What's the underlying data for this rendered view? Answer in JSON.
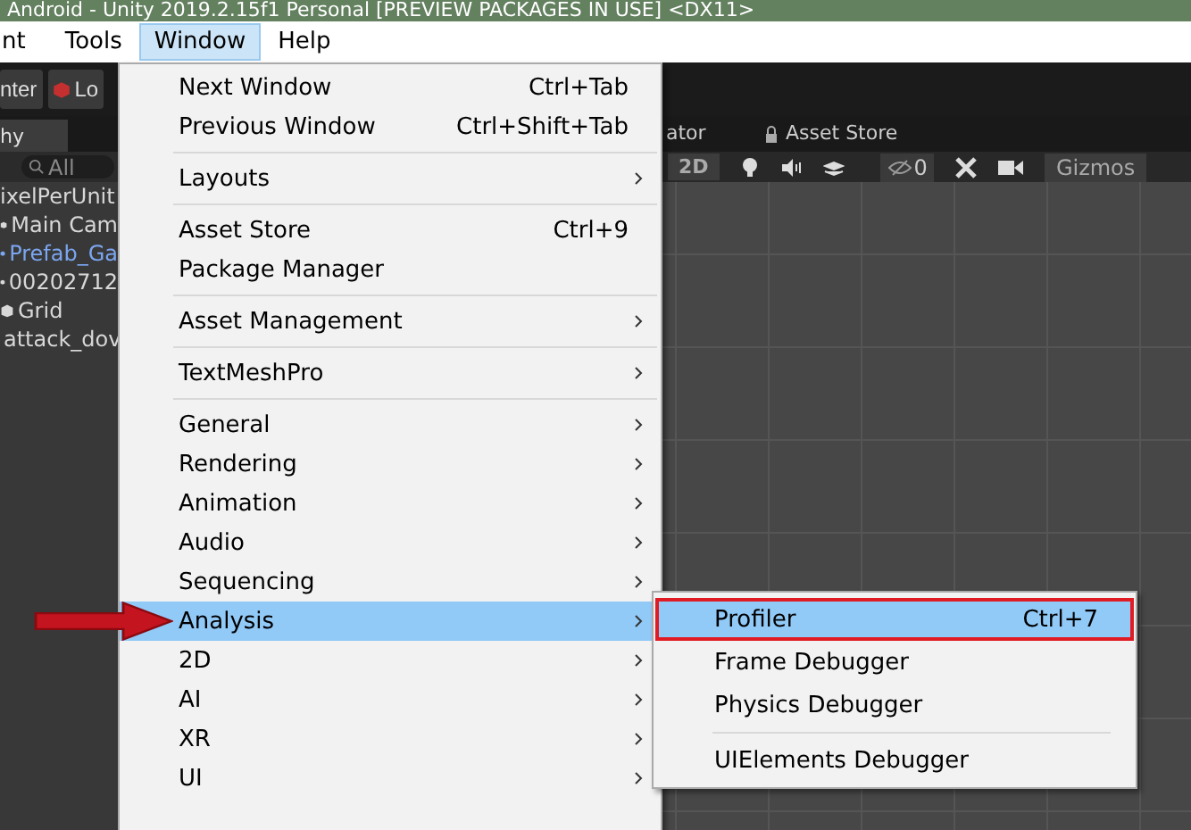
{
  "window": {
    "title": "Android - Unity 2019.2.15f1 Personal [PREVIEW PACKAGES IN USE] <DX11>"
  },
  "menu_bar": [
    {
      "label": "nt",
      "selected": false
    },
    {
      "label": "Tools",
      "selected": false
    },
    {
      "label": "Window",
      "selected": true
    },
    {
      "label": "Help",
      "selected": false
    }
  ],
  "toolbar": {
    "buttons": [
      "nter",
      "Lo"
    ]
  },
  "tabs": [
    {
      "label": "hy",
      "selected": true
    },
    {
      "label": "ator",
      "selected": false
    },
    {
      "label": "Asset Store",
      "selected": false
    }
  ],
  "hierarchy": {
    "search_placeholder": "All",
    "items": [
      {
        "label": "ixelPerUnit",
        "kind": "scene",
        "selected": false
      },
      {
        "label": "Main Cam",
        "kind": "object",
        "selected": false
      },
      {
        "label": "Prefab_Ga",
        "kind": "prefab",
        "selected": false
      },
      {
        "label": "00202712",
        "kind": "object",
        "selected": false
      },
      {
        "label": "Grid",
        "kind": "object",
        "selected": false
      },
      {
        "label": "attack_dov",
        "kind": "object",
        "selected": false
      }
    ]
  },
  "scene_toolbar": {
    "mode": "2D",
    "hidden_count": "0",
    "gizmos": "Gizmos"
  },
  "window_menu": [
    [
      {
        "label": "Next Window",
        "shortcut": "Ctrl+Tab",
        "submenu": false,
        "selected": false
      },
      {
        "label": "Previous Window",
        "shortcut": "Ctrl+Shift+Tab",
        "submenu": false,
        "selected": false
      }
    ],
    [
      {
        "label": "Layouts",
        "submenu": true,
        "selected": false
      }
    ],
    [
      {
        "label": "Asset Store",
        "shortcut": "Ctrl+9",
        "submenu": false,
        "selected": false
      },
      {
        "label": "Package Manager",
        "submenu": false,
        "selected": false
      }
    ],
    [
      {
        "label": "Asset Management",
        "submenu": true,
        "selected": false
      }
    ],
    [
      {
        "label": "TextMeshPro",
        "submenu": true,
        "selected": false
      }
    ],
    [
      {
        "label": "General",
        "submenu": true,
        "selected": false
      },
      {
        "label": "Rendering",
        "submenu": true,
        "selected": false
      },
      {
        "label": "Animation",
        "submenu": true,
        "selected": false
      },
      {
        "label": "Audio",
        "submenu": true,
        "selected": false
      },
      {
        "label": "Sequencing",
        "submenu": true,
        "selected": false
      },
      {
        "label": "Analysis",
        "submenu": true,
        "selected": true
      },
      {
        "label": "2D",
        "submenu": true,
        "selected": false
      },
      {
        "label": "AI",
        "submenu": true,
        "selected": false
      },
      {
        "label": "XR",
        "submenu": true,
        "selected": false
      },
      {
        "label": "UI",
        "submenu": true,
        "selected": false
      }
    ]
  ],
  "analysis_submenu": [
    [
      {
        "label": "Profiler",
        "shortcut": "Ctrl+7",
        "selected": true,
        "highlighted": true
      },
      {
        "label": "Frame Debugger",
        "selected": false,
        "highlighted": false
      },
      {
        "label": "Physics Debugger",
        "selected": false,
        "highlighted": false
      }
    ],
    [
      {
        "label": "UIElements Debugger",
        "selected": false,
        "highlighted": false
      }
    ]
  ]
}
